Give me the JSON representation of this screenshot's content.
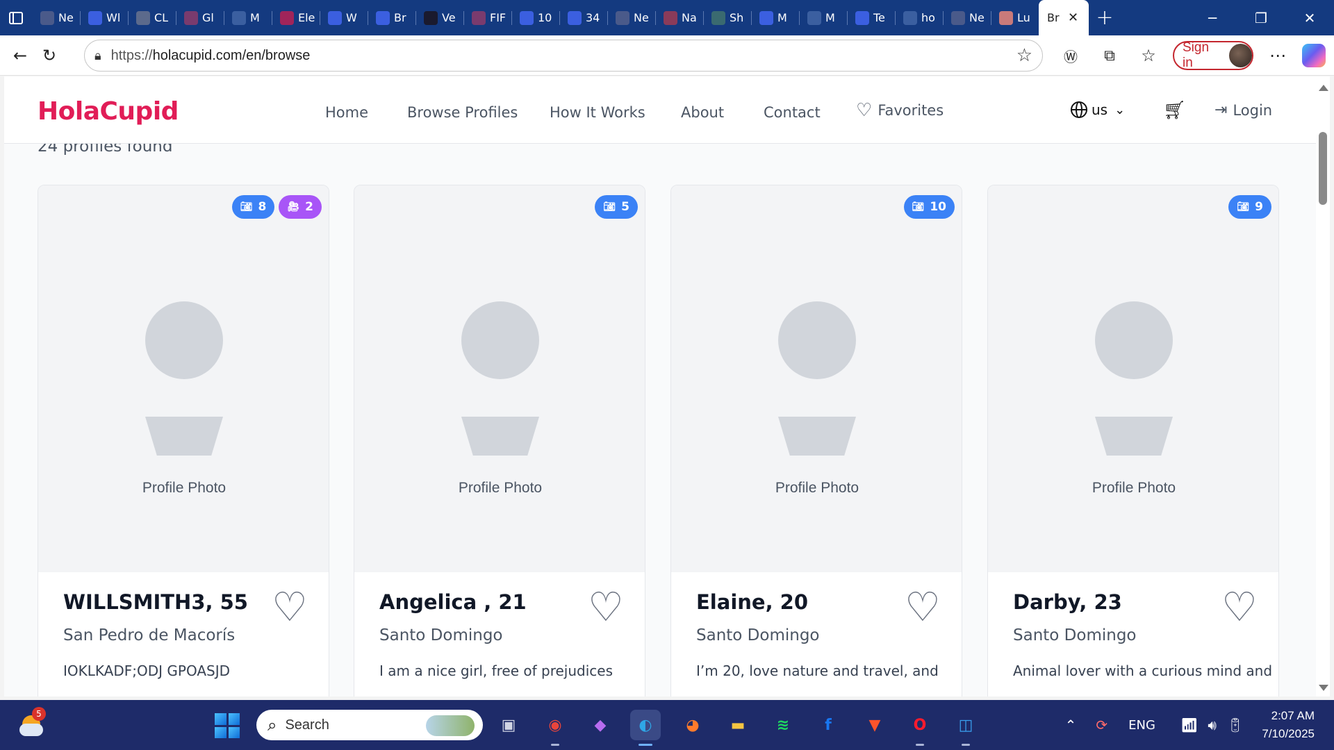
{
  "browser": {
    "tabs": [
      {
        "label": "Ne",
        "icon": "page-icon",
        "color": "#4a5a8a"
      },
      {
        "label": "Wl",
        "icon": "butterfly-icon",
        "color": "#3b5fe0"
      },
      {
        "label": "CL",
        "icon": "chatgpt-icon",
        "color": "#5c6a8c"
      },
      {
        "label": "Gl",
        "icon": "pdf-icon",
        "color": "#7a3b6e"
      },
      {
        "label": "M",
        "icon": "globe-icon",
        "color": "#3b5fa0"
      },
      {
        "label": "Ele",
        "icon": "youtube-icon",
        "color": "#a0245a"
      },
      {
        "label": "W",
        "icon": "butterfly-icon",
        "color": "#3b5fe0"
      },
      {
        "label": "Br",
        "icon": "butterfly-icon",
        "color": "#3b5fe0"
      },
      {
        "label": "Ve",
        "icon": "ts-icon",
        "color": "#1a1a2e"
      },
      {
        "label": "FIF",
        "icon": "pdf-icon",
        "color": "#7a3b6e"
      },
      {
        "label": "10",
        "icon": "butterfly-icon",
        "color": "#3b5fe0"
      },
      {
        "label": "34",
        "icon": "butterfly-icon",
        "color": "#3b5fe0"
      },
      {
        "label": "Ne",
        "icon": "page-icon",
        "color": "#4a5a8a"
      },
      {
        "label": "Na",
        "icon": "n-icon",
        "color": "#8a3b5a"
      },
      {
        "label": "Sh",
        "icon": "app-icon",
        "color": "#3a6a70"
      },
      {
        "label": "M",
        "icon": "butterfly-icon",
        "color": "#3b5fe0"
      },
      {
        "label": "M",
        "icon": "globe-icon",
        "color": "#3b5fa0"
      },
      {
        "label": "Te",
        "icon": "butterfly-icon",
        "color": "#3b5fe0"
      },
      {
        "label": "ho",
        "icon": "globe-icon",
        "color": "#3b5fa0"
      },
      {
        "label": "Ne",
        "icon": "page-icon",
        "color": "#4a5a8a"
      },
      {
        "label": "Lu",
        "icon": "avatar-icon",
        "color": "#c97a7a"
      }
    ],
    "active_tab": {
      "label": "Br"
    },
    "url_protocol": "https://",
    "url_rest": "holacupid.com/en/browse",
    "signin_label": "Sign in"
  },
  "site": {
    "brand": "HolaCupid",
    "brand_color": "#e11d57",
    "nav": {
      "home": "Home",
      "browse": "Browse Profiles",
      "how": "How It Works",
      "about": "About",
      "contact": "Contact",
      "favorites": "Favorites"
    },
    "lang": "us",
    "login": "Login",
    "profiles_count_text": "24 profiles found"
  },
  "profiles": [
    {
      "name": "WILLSMITH3, 55",
      "location": "San Pedro de Macorís",
      "bio": "IOKLKADF;ODJ GPOASJD",
      "photos": "8",
      "videos": "2",
      "photo_label": "Profile Photo"
    },
    {
      "name": "Angelica , 21",
      "location": "Santo Domingo",
      "bio": "I am a nice girl, free of prejudices",
      "photos": "5",
      "photo_label": "Profile Photo"
    },
    {
      "name": "Elaine, 20",
      "location": "Santo Domingo",
      "bio": "I’m 20, love nature and travel, and",
      "photos": "10",
      "photo_label": "Profile Photo"
    },
    {
      "name": "Darby, 23",
      "location": "Santo Domingo",
      "bio": "Animal lover with a curious mind and",
      "photos": "9",
      "photo_label": "Profile Photo"
    }
  ],
  "taskbar": {
    "weather_badge": "5",
    "search_placeholder": "Search",
    "apps": [
      "task-view-icon",
      "chrome-icon",
      "copilot-icon",
      "edge-icon",
      "firefox-icon",
      "file-explorer-icon",
      "spotify-icon",
      "facebook-icon",
      "brave-icon",
      "opera-icon",
      "store-icon"
    ],
    "lang": "ENG",
    "time": "2:07 AM",
    "date": "7/10/2025"
  }
}
